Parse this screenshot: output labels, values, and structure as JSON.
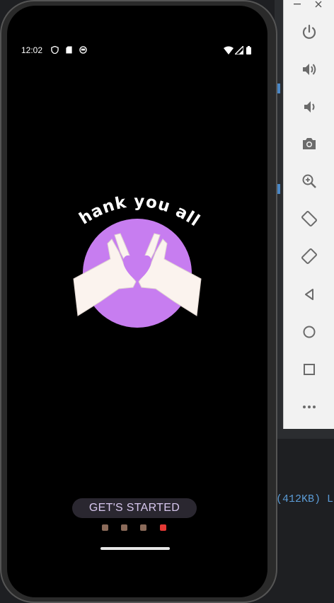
{
  "status_bar": {
    "time": "12:02",
    "left_icons": [
      "shield-icon",
      "sim-card-icon",
      "face-icon"
    ],
    "right_icons": [
      "wifi-icon",
      "signal-icon",
      "battery-icon"
    ]
  },
  "onboarding": {
    "headline": "Thank you all!",
    "cta_label": "GET'S STARTED",
    "page_count": 4,
    "active_page_index": 3,
    "colors": {
      "circle": "#c77df0",
      "hands": "#fbf3ee",
      "heart": "#ff5fc8",
      "cta_bg": "#2a2730",
      "cta_text": "#d7c7ee",
      "dot": "#8b6b5a",
      "dot_active": "#e53935"
    }
  },
  "emulator_toolbar": {
    "window_controls": [
      "minimize-icon",
      "close-icon"
    ],
    "items": [
      "power-icon",
      "volume-up-icon",
      "volume-down-icon",
      "camera-icon",
      "zoom-icon",
      "rotate-left-icon",
      "rotate-right-icon",
      "back-icon",
      "home-icon",
      "overview-icon",
      "more-icon"
    ]
  },
  "ide_console": {
    "log_fragment": "(412KB) L"
  }
}
